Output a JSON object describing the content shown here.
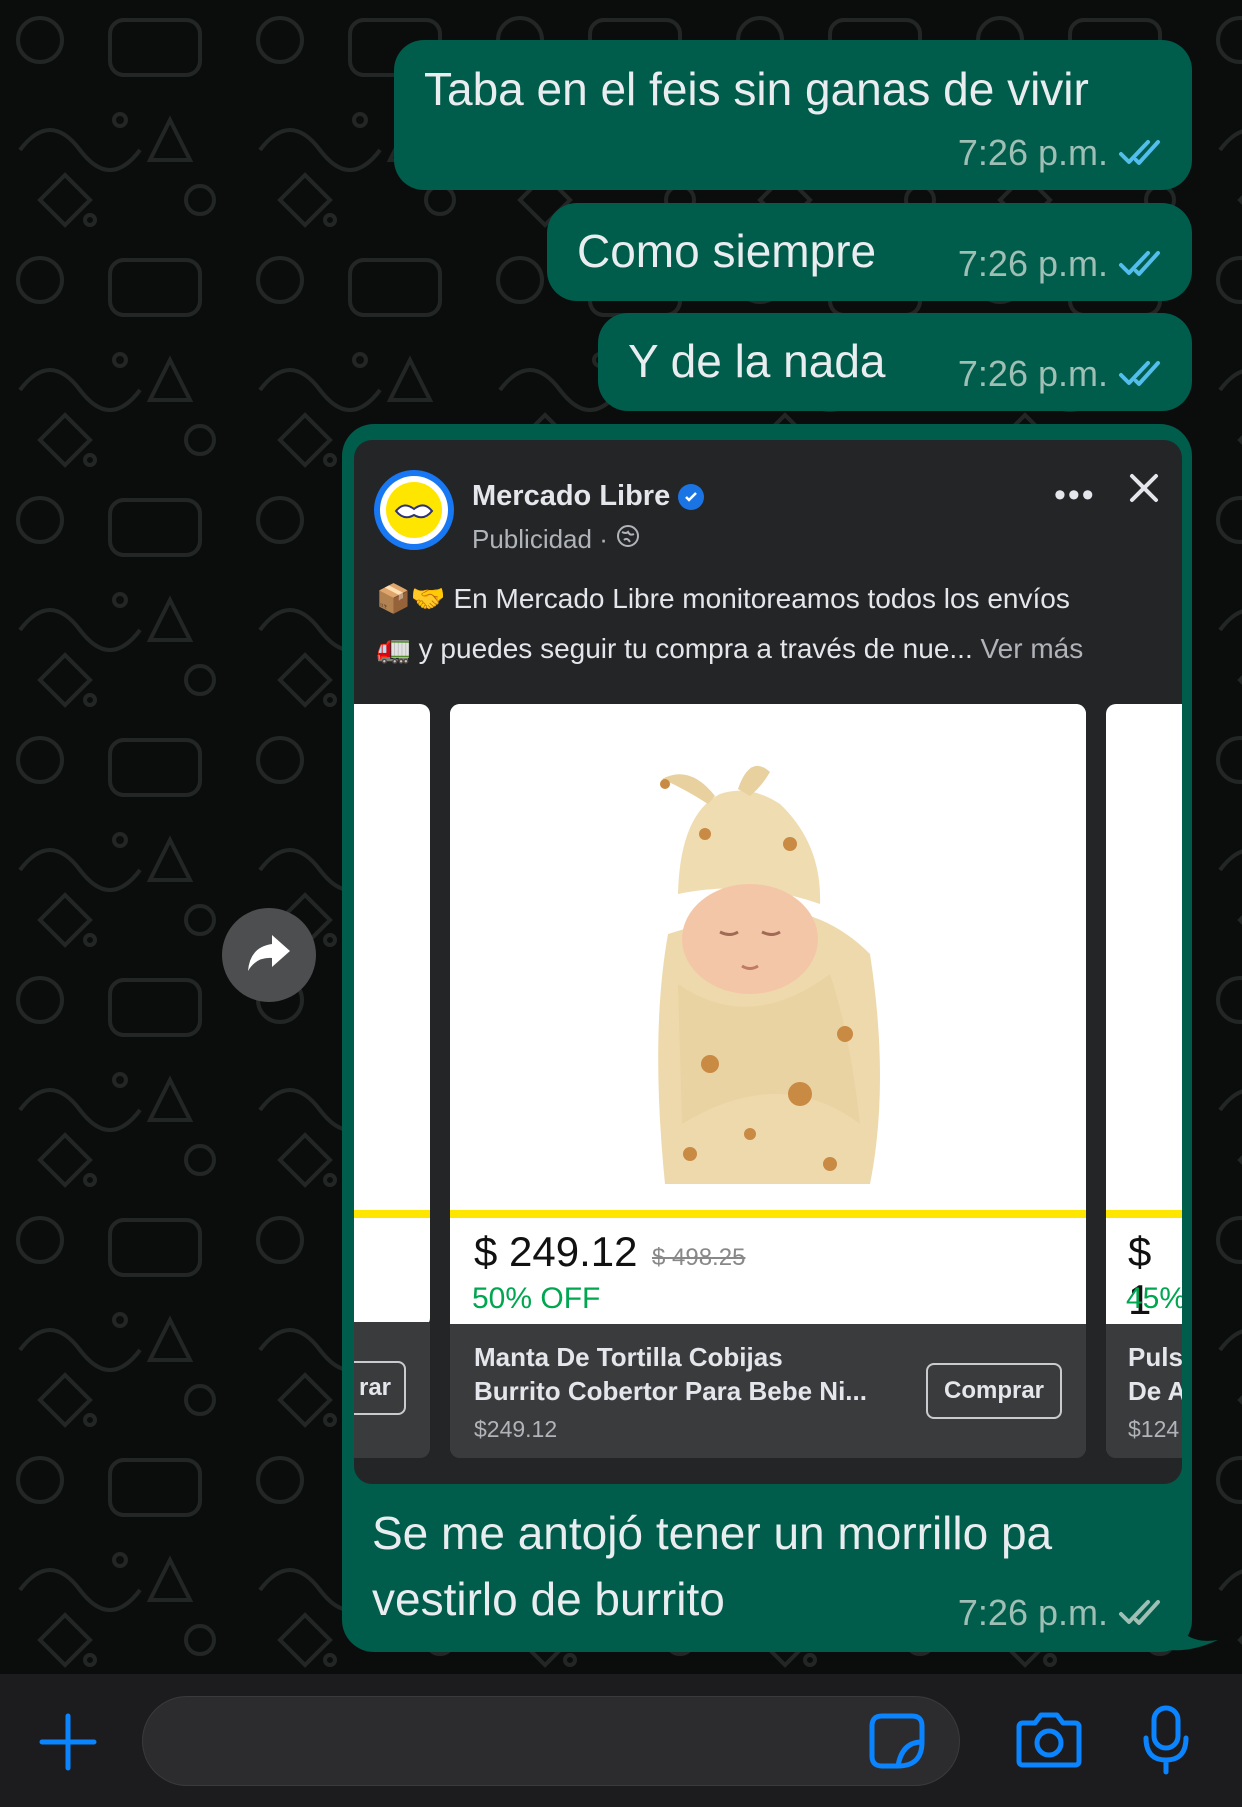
{
  "messages": [
    {
      "text": "Taba en el feis sin ganas de vivir",
      "time": "7:26 p.m."
    },
    {
      "text": "Como siempre",
      "time": "7:26 p.m."
    },
    {
      "text": "Y de la nada",
      "time": "7:26 p.m."
    },
    {
      "line1": "Se me antojó tener un morrillo pa",
      "line2": "vestirlo de burrito",
      "time": "7:26 p.m."
    }
  ],
  "ad": {
    "page_name": "Mercado Libre",
    "sponsored": "Publicidad ·",
    "body_line1": "📦🤝 En Mercado Libre monitoreamos todos los envíos",
    "body_line2": "🚛 y puedes seguir tu compra a través de nue...",
    "see_more": "Ver más",
    "more_label": "•••",
    "products": [
      {
        "button": "rar"
      },
      {
        "price": "$ 249.12",
        "old_price": "$ 498.25",
        "discount": "50% OFF",
        "title_line1": "Manta De Tortilla Cobijas",
        "title_line2": "Burrito Cobertor Para Bebe Ni...",
        "footer_price": "$249.12",
        "button": "Comprar"
      },
      {
        "price": "$ 1",
        "discount": "45%",
        "title_line1": "Puls",
        "title_line2": "De A",
        "footer_price": "$124"
      }
    ]
  },
  "icons": {
    "read_receipt": "double-check-icon",
    "forward": "forward-arrow-icon",
    "attach": "plus-icon",
    "sticker": "sticker-icon",
    "camera": "camera-icon",
    "mic": "microphone-icon"
  },
  "colors": {
    "bubble": "#005c4b",
    "read_tick": "#53bdeb",
    "accent_blue": "#0a84ff",
    "brand_yellow": "#ffe600",
    "discount_green": "#00a650"
  }
}
